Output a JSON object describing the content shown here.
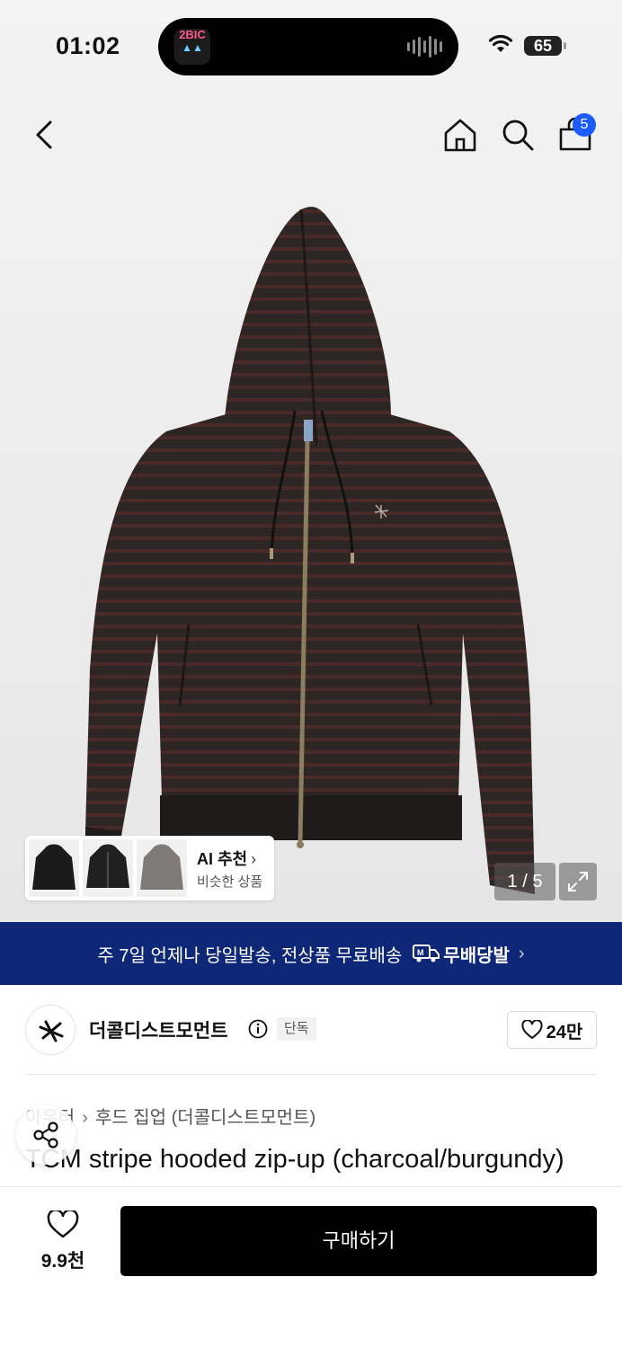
{
  "status_bar": {
    "time": "01:02",
    "battery": "65",
    "island_app_top": "2BIC"
  },
  "nav": {
    "cart_count": "5"
  },
  "ai_recommend": {
    "title": "AI 추천",
    "chevron": "›",
    "subtitle": "비슷한 상품"
  },
  "gallery": {
    "counter": "1 / 5"
  },
  "promo": {
    "text": "주 7일 언제나 당일발송, 전상품 무료배송",
    "logo_text": "무배당발",
    "chevron": "›"
  },
  "brand": {
    "name": "더콜디스트모먼트",
    "tag": "단독",
    "likes": "24만"
  },
  "breadcrumb": {
    "category": "아우터",
    "subcategory": "후드 집업 (더콜디스트모먼트)"
  },
  "product": {
    "title": "TCM stripe hooded zip-up (charcoal/burgundy)"
  },
  "bottom_bar": {
    "wish_count": "9.9천",
    "buy_label": "구매하기"
  },
  "colors": {
    "promo_bg": "#0e2777",
    "badge": "#1c5cff",
    "buy_bg": "#000000"
  },
  "icons": [
    "back-icon",
    "home-icon",
    "search-icon",
    "cart-icon",
    "expand-icon",
    "info-icon",
    "heart-icon",
    "share-icon",
    "wifi-icon"
  ]
}
